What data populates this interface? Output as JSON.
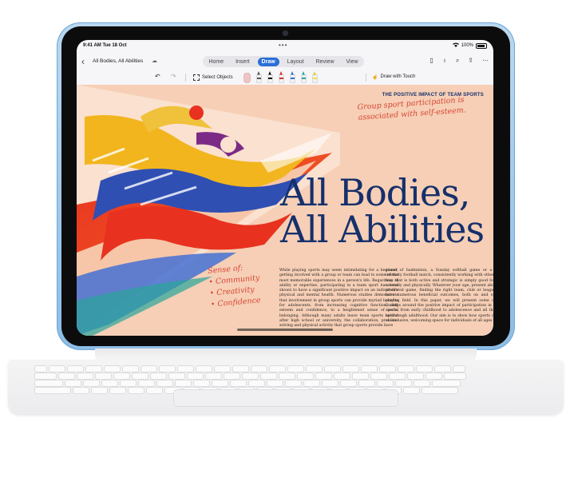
{
  "status_bar": {
    "time": "9:41 AM  Tue 18 Oct",
    "dots": "•••",
    "battery": "100%"
  },
  "titlebar": {
    "back_icon": "chevron-left-icon",
    "doc_title": "All Bodies, All Abilities",
    "cloud_icon": "cloud-sync-icon",
    "tabs": [
      "Home",
      "Insert",
      "Draw",
      "Layout",
      "Review",
      "View"
    ],
    "active_tab": "Draw",
    "right_icons": [
      "phone-icon",
      "lightbulb-icon",
      "search-icon",
      "share-icon",
      "more-icon"
    ]
  },
  "ribbon": {
    "select_objects": "Select Objects",
    "draw_with_touch": "Draw with Touch",
    "pens": [
      {
        "name": "eraser-tool",
        "color": "#f1c3c3"
      },
      {
        "name": "pencil-gray",
        "color": "#555555"
      },
      {
        "name": "pen-black",
        "color": "#111111"
      },
      {
        "name": "pen-red",
        "color": "#d92b2b"
      },
      {
        "name": "pen-blue",
        "color": "#2f6fd0"
      },
      {
        "name": "pen-teal",
        "color": "#2aa59a"
      },
      {
        "name": "highlighter-yellow",
        "color": "#f4e13a"
      }
    ]
  },
  "document": {
    "kicker": "THE POSITIVE IMPACT OF TEAM SPORTS",
    "ink_note_top": "Group sport participation is associated with self-esteem.",
    "ink_note_sense": [
      "Sense of:",
      "• Community",
      "• Creativity",
      "• Confidence"
    ],
    "headline_line1": "All Bodies,",
    "headline_line2": "All Abilities",
    "column1": "While playing sports may seem intimidating for a beginner, getting involved with a group or team can lead to some of the most memorable experiences in a person's life. Regardless of ability or expertise, participating in a team sport has been shown to have a significant positive impact on an individual's physical and mental health. Numerous studies demonstrate that involvement in group sports can provide myriad benefits for adolescents, from increasing cognitive function, self-esteem and confidence, to a heightened sense of social belonging. Although many adults leave team sports behind after high school or university, the collaboration, problem-solving and physical activity that group sports provide have",
    "column2": "round of badminton, a Sunday softball game or a high-intensity football match, consistently working with others in a way that is both active and strategic is simply good for you, mentally and physically. Whatever your age, present ability or preferred game, finding the right team, club or league can have numerous beneficial outcomes, both on and off the playing field.\nIn this paper, we will present some of our findings around the positive impact of participation in group sports, from early childhood to adolescence and all the way up through adulthood. Our aim is to show how sports can be an inclusive, welcoming space for individuals of all ages"
  },
  "colors": {
    "accent_tab": "#2b6fd6",
    "headline": "#15306c",
    "ink": "#d84535",
    "page_bg": "#f6cfb6",
    "device_frame": "#9cc6ea"
  }
}
